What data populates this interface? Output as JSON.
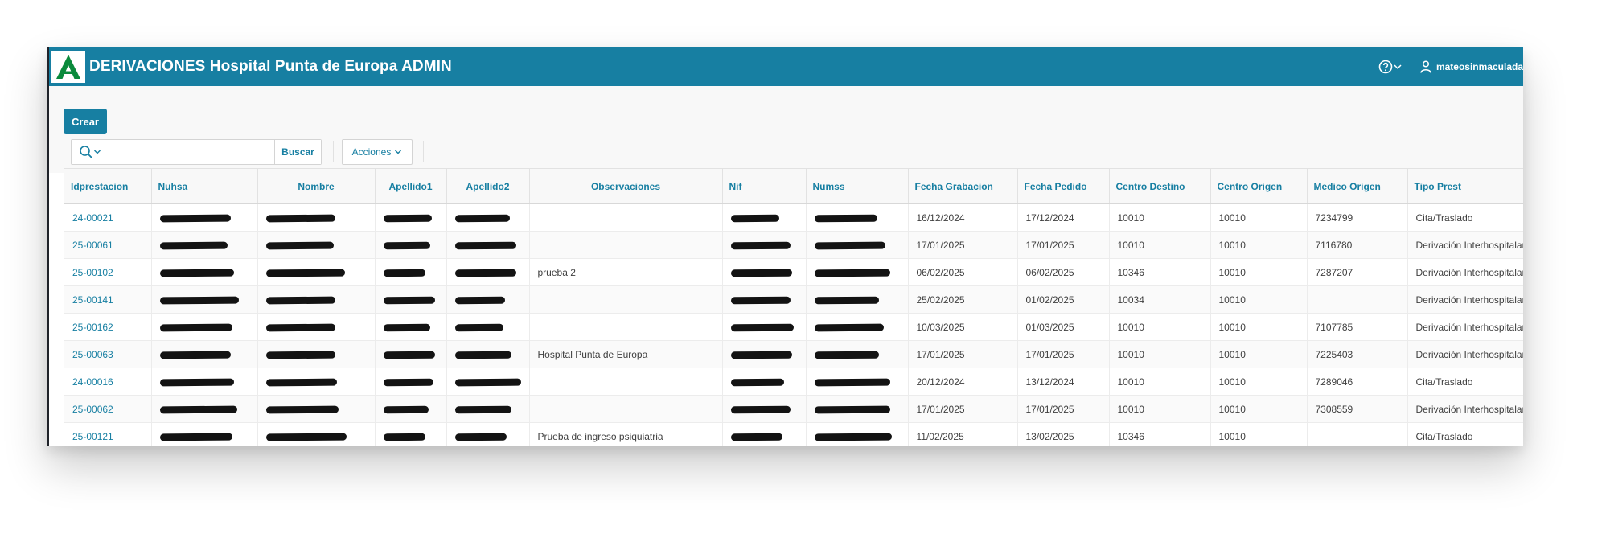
{
  "app": {
    "title": "DERIVACIONES Hospital Punta de Europa ADMIN",
    "user": "mateosinmaculada",
    "accent": "#177fa2"
  },
  "toolbar": {
    "create_label": "Crear",
    "search_placeholder": "",
    "search_value": "",
    "search_button": "Buscar",
    "actions_label": "Acciones"
  },
  "icons": {
    "help": "help-circle-icon",
    "user": "user-icon",
    "search": "search-icon",
    "chevron": "chevron-down-icon"
  },
  "table": {
    "columns": [
      "Idprestacion",
      "Nuhsa",
      "Nombre",
      "Apellido1",
      "Apellido2",
      "Observaciones",
      "Nif",
      "Numss",
      "Fecha Grabacion",
      "Fecha Pedido",
      "Centro Destino",
      "Centro Origen",
      "Medico Origen",
      "Tipo Prest"
    ],
    "rows": [
      {
        "id": "24-00021",
        "observaciones": "",
        "fecha_grabacion": "16/12/2024",
        "fecha_pedido": "17/12/2024",
        "centro_destino": "10010",
        "centro_origen": "10010",
        "medico_origen": "7234799",
        "tipo_prest": "Cita/Traslado"
      },
      {
        "id": "25-00061",
        "observaciones": "",
        "fecha_grabacion": "17/01/2025",
        "fecha_pedido": "17/01/2025",
        "centro_destino": "10010",
        "centro_origen": "10010",
        "medico_origen": "7116780",
        "tipo_prest": "Derivación Interhospitalaria"
      },
      {
        "id": "25-00102",
        "observaciones": "prueba 2",
        "fecha_grabacion": "06/02/2025",
        "fecha_pedido": "06/02/2025",
        "centro_destino": "10346",
        "centro_origen": "10010",
        "medico_origen": "7287207",
        "tipo_prest": "Derivación Interhospitalaria"
      },
      {
        "id": "25-00141",
        "observaciones": "",
        "fecha_grabacion": "25/02/2025",
        "fecha_pedido": "01/02/2025",
        "centro_destino": "10034",
        "centro_origen": "10010",
        "medico_origen": "",
        "tipo_prest": "Derivación Interhospitalaria"
      },
      {
        "id": "25-00162",
        "observaciones": "",
        "fecha_grabacion": "10/03/2025",
        "fecha_pedido": "01/03/2025",
        "centro_destino": "10010",
        "centro_origen": "10010",
        "medico_origen": "7107785",
        "tipo_prest": "Derivación Interhospitalaria"
      },
      {
        "id": "25-00063",
        "observaciones": "Hospital Punta de Europa",
        "fecha_grabacion": "17/01/2025",
        "fecha_pedido": "17/01/2025",
        "centro_destino": "10010",
        "centro_origen": "10010",
        "medico_origen": "7225403",
        "tipo_prest": "Derivación Interhospitalaria"
      },
      {
        "id": "24-00016",
        "observaciones": "",
        "fecha_grabacion": "20/12/2024",
        "fecha_pedido": "13/12/2024",
        "centro_destino": "10010",
        "centro_origen": "10010",
        "medico_origen": "7289046",
        "tipo_prest": "Cita/Traslado"
      },
      {
        "id": "25-00062",
        "observaciones": "",
        "fecha_grabacion": "17/01/2025",
        "fecha_pedido": "17/01/2025",
        "centro_destino": "10010",
        "centro_origen": "10010",
        "medico_origen": "7308559",
        "tipo_prest": "Derivación Interhospitalaria"
      },
      {
        "id": "25-00121",
        "observaciones": "Prueba de ingreso psiquiatria",
        "fecha_grabacion": "11/02/2025",
        "fecha_pedido": "13/02/2025",
        "centro_destino": "10346",
        "centro_origen": "10010",
        "medico_origen": "",
        "tipo_prest": "Cita/Traslado"
      }
    ]
  }
}
